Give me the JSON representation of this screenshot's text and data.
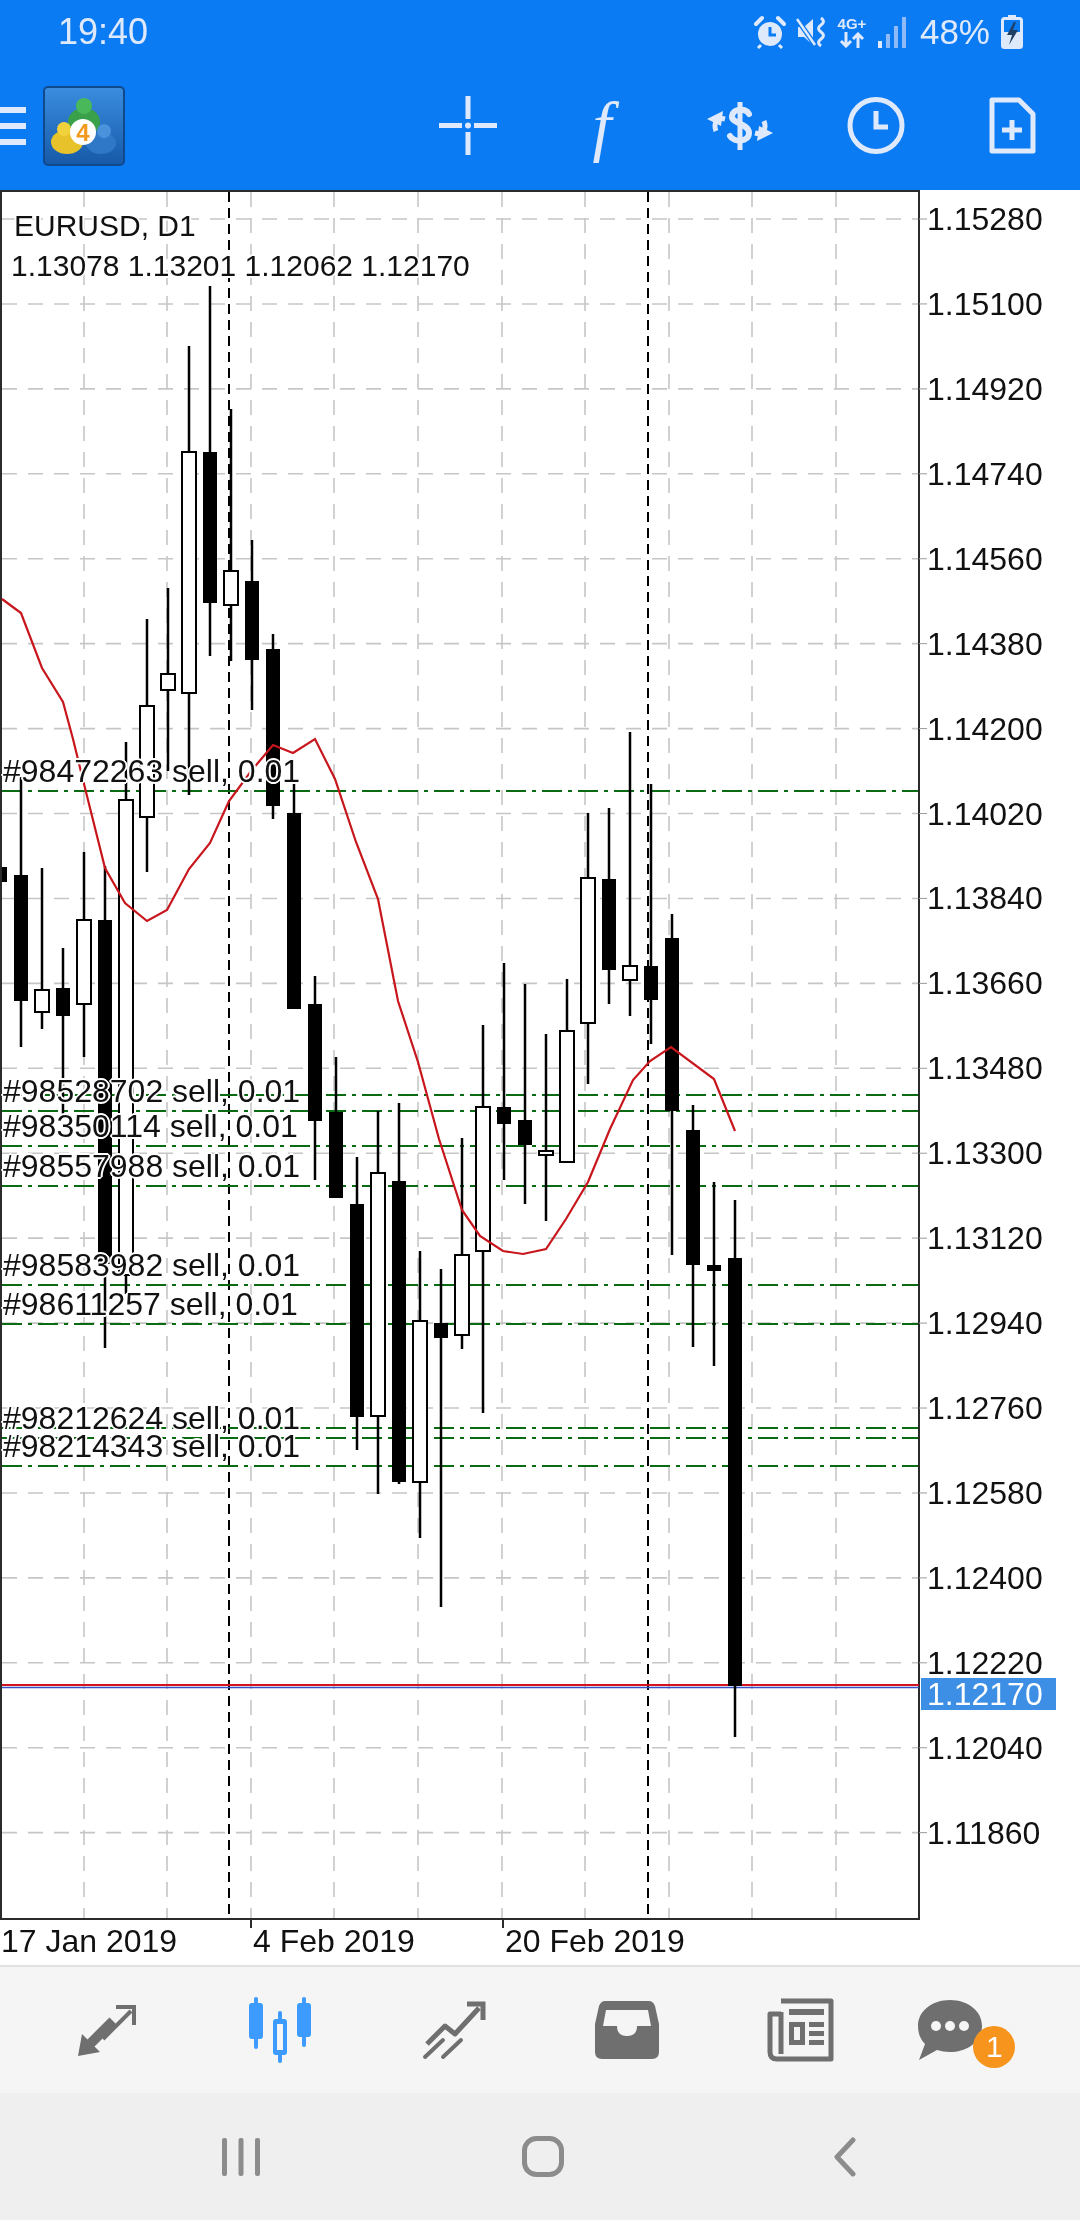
{
  "status_bar": {
    "time": "19:40",
    "network": "4G+",
    "battery": "48%"
  },
  "toolbar": {
    "logo_badge": "4",
    "indicator_symbol": "f"
  },
  "chart": {
    "title": "EURUSD, D1",
    "ohlc": "1.13078 1.13201 1.12062 1.12170",
    "order_labels": [
      "#98472263 sell, 0.01",
      "#98528702 sell, 0.01",
      "#98350114 sell, 0.01",
      "#98557988 sell, 0.01",
      "#98583982 sell, 0.01",
      "#98611257 sell, 0.01",
      "#98212624 sell, 0.01",
      "#98214343 sell, 0.01"
    ],
    "price_labels": [
      "1.15280",
      "1.15100",
      "1.14920",
      "1.14740",
      "1.14560",
      "1.14380",
      "1.14200",
      "1.14020",
      "1.13840",
      "1.13660",
      "1.13480",
      "1.13300",
      "1.13120",
      "1.12940",
      "1.12760",
      "1.12580",
      "1.12400",
      "1.12220",
      "1.12040",
      "1.11860"
    ],
    "current_price": "1.12170",
    "date_labels": [
      "17 Jan 2019",
      "4 Feb 2019",
      "20 Feb 2019"
    ]
  },
  "bottom_nav": [
    {
      "selected": false
    },
    {
      "selected": true
    },
    {
      "selected": false
    },
    {
      "selected": false
    },
    {
      "selected": false
    },
    {
      "selected": false,
      "badge": "1"
    }
  ]
}
